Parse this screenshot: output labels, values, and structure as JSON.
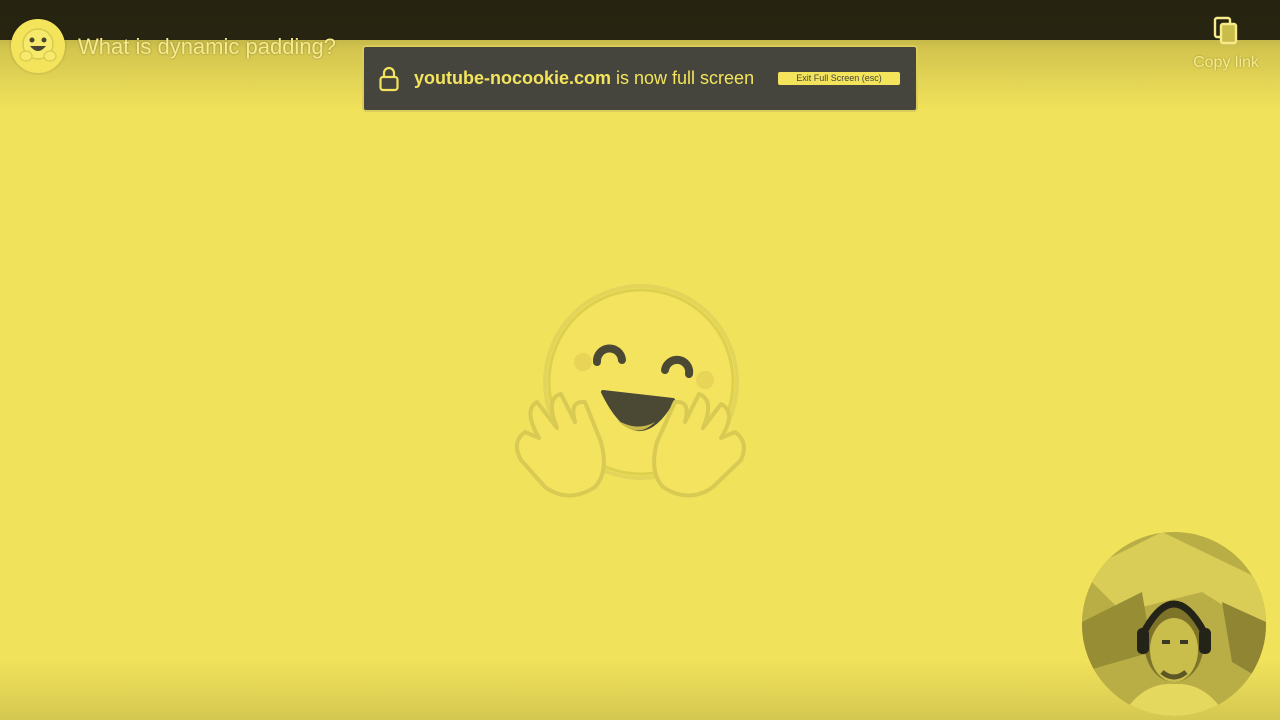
{
  "video": {
    "title": "What is dynamic padding?"
  },
  "channel": {
    "avatar_icon": "hugging-face-emoji-icon"
  },
  "share": {
    "copy_icon": "copy-icon",
    "copy_label": "Copy link"
  },
  "fullscreen_notice": {
    "lock_icon": "lock-icon",
    "domain": "youtube-nocookie.com",
    "message": " is now full screen",
    "exit_label": "Exit Full Screen (esc)"
  },
  "center_logo": {
    "icon": "hugging-face-logo-icon"
  },
  "presenter_cam": {
    "icon": "presenter-webcam"
  },
  "colors": {
    "background": "#f1e25b",
    "banner": "#45453e",
    "accent": "#f3e45c"
  }
}
